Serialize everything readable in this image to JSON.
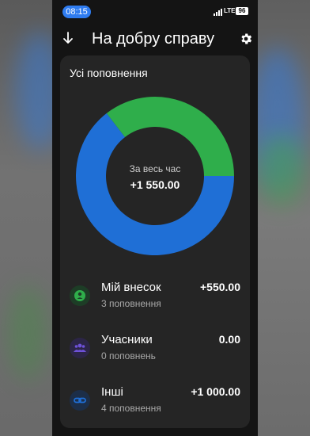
{
  "status_bar": {
    "time": "08:15",
    "network": "LTE",
    "battery": "96"
  },
  "header": {
    "title": "На добру справу",
    "back_icon": "arrow-down-icon",
    "settings_icon": "gear-icon"
  },
  "card": {
    "title": "Усі поповнення",
    "center_label": "За весь час",
    "center_value": "+1 550.00"
  },
  "chart_data": {
    "type": "pie",
    "values": [
      1000,
      550,
      0
    ],
    "colors": [
      "#1f6fd6",
      "#2fae4b",
      "#6e52d8"
    ]
  },
  "contributions": [
    {
      "name": "Мій внесок",
      "count": "3 поповнення",
      "amount": "+550.00",
      "icon": "person-icon",
      "color": "#2fae4b"
    },
    {
      "name": "Учасники",
      "count": "0 поповнень",
      "amount": "0.00",
      "icon": "group-icon",
      "color": "#6e52d8"
    },
    {
      "name": "Інші",
      "count": "4 поповнення",
      "amount": "+1 000.00",
      "icon": "link-icon",
      "color": "#1f6fd6"
    }
  ]
}
